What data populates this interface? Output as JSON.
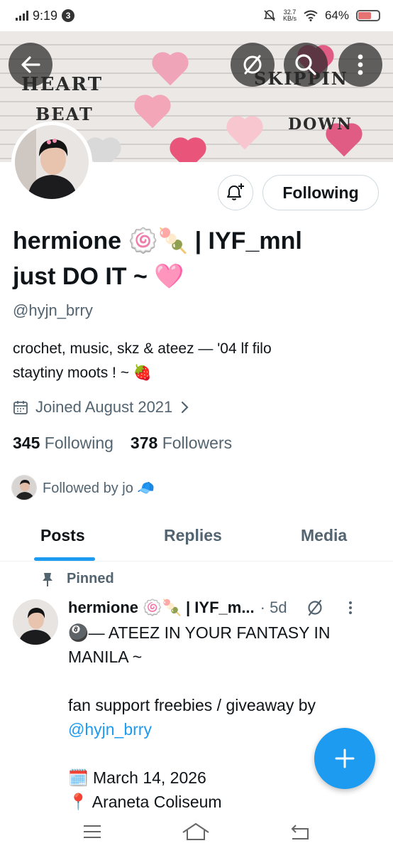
{
  "status_bar": {
    "time": "9:19",
    "notification_count": "3",
    "net_speed_value": "32.7",
    "net_speed_unit": "KB/s",
    "battery": "64%",
    "battery_level": 0.64
  },
  "banner": {
    "words": [
      "HEART",
      "BEAT",
      "SKIPPIN",
      "DOWN"
    ],
    "icons": {
      "back": "arrow-left-icon",
      "grok": "slash-circle-icon",
      "search": "search-icon",
      "more": "more-vertical-icon"
    }
  },
  "profile": {
    "display_name_line1": "hermione 🍥🍡 | IYF_mnl",
    "display_name_line2": "just DO IT ~ 🩷",
    "handle": "@hyjn_brry",
    "bio_line1": "crochet, music, skz & ateez — '04 lf filo",
    "bio_line2": "staytiny moots ! ~ 🍓",
    "joined": "Joined August 2021",
    "following_count": "345",
    "following_label": "Following",
    "followers_count": "378",
    "followers_label": "Followers",
    "followed_by": "Followed by jo 🧢"
  },
  "actions": {
    "notify_icon": "bell-plus-icon",
    "following_button": "Following"
  },
  "tabs": [
    {
      "label": "Posts",
      "active": true
    },
    {
      "label": "Replies",
      "active": false
    },
    {
      "label": "Media",
      "active": false
    }
  ],
  "post": {
    "pinned_label": "Pinned",
    "author": "hermione 🍥🍡 | IYF_m...",
    "time": "· 5d",
    "lines": [
      "🎱— ATEEZ IN YOUR FANTASY IN",
      "MANILA ~",
      "",
      "fan support freebies / giveaway by",
      "@hyjn_brry",
      "",
      "🗓️ March 14, 2026",
      "📍 Araneta Coliseum"
    ]
  },
  "colors": {
    "accent": "#1d9bf0",
    "text": "#0f1419",
    "secondary": "#536471"
  }
}
